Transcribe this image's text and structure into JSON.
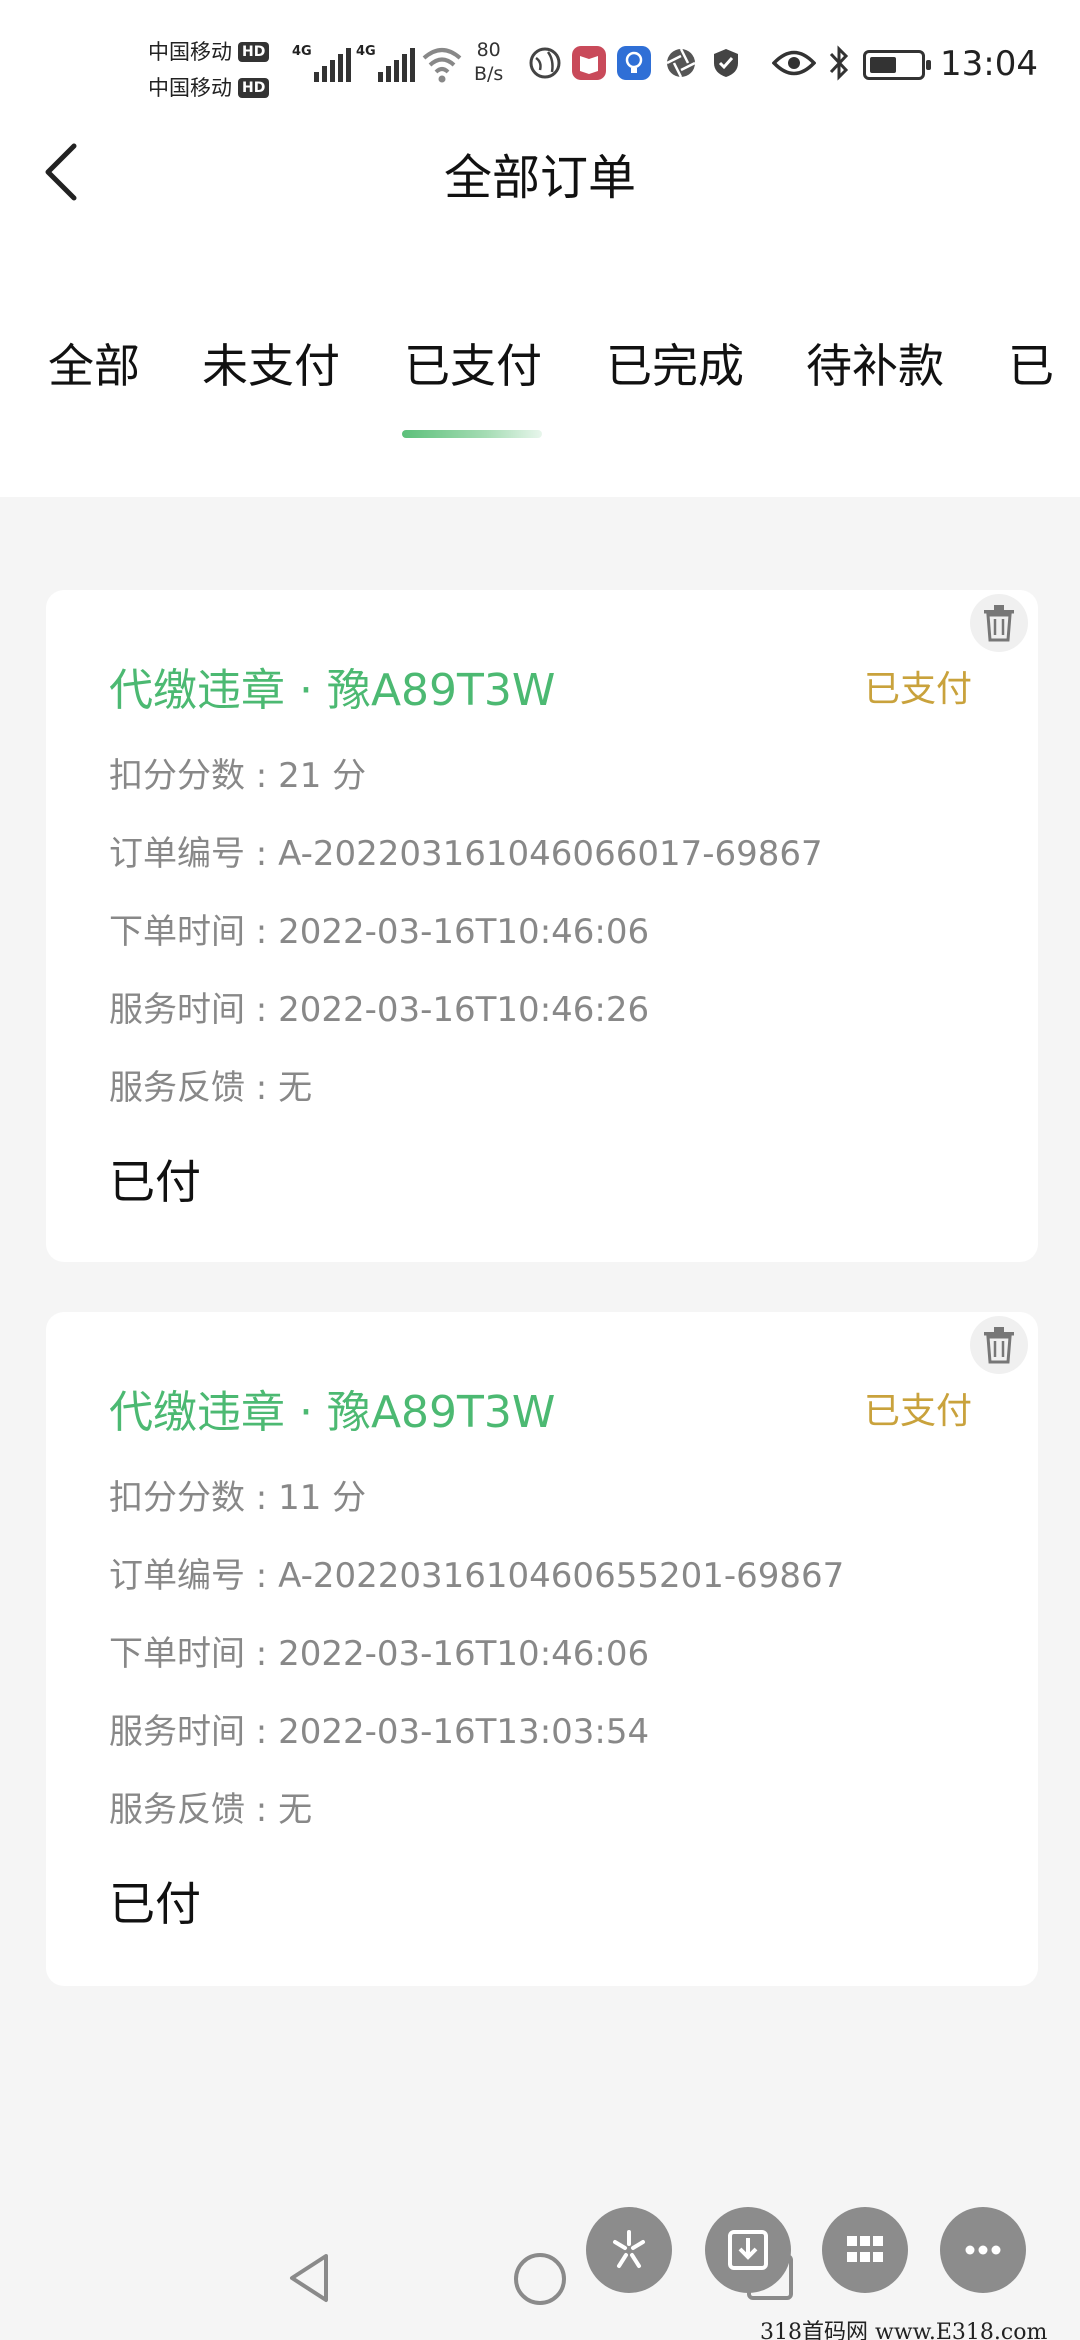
{
  "status_bar": {
    "carrier1": "中国移动",
    "carrier2": "中国移动",
    "hd_badge": "HD",
    "net_label": "4G",
    "speed_value": "80",
    "speed_unit": "B/s",
    "time": "13:04",
    "battery_level": 0.55
  },
  "header": {
    "title": "全部订单"
  },
  "tabs": [
    {
      "label": "全部"
    },
    {
      "label": "未支付"
    },
    {
      "label": "已支付"
    },
    {
      "label": "已完成"
    },
    {
      "label": "待补款"
    },
    {
      "label": "已"
    }
  ],
  "orders": [
    {
      "title": "代缴违章 · 豫A89T3W",
      "status": "已支付",
      "points": "扣分分数 : 21 分",
      "order_no": "订单编号 : A-202203161046066017-69867",
      "order_time": "下单时间 : 2022-03-16T10:46:06",
      "service_time": "服务时间 : 2022-03-16T10:46:26",
      "feedback": "服务反馈 : 无",
      "paid": "已付"
    },
    {
      "title": "代缴违章 · 豫A89T3W",
      "status": "已支付",
      "points": "扣分分数 : 11 分",
      "order_no": "订单编号 : A-202203161046065520​1-69867",
      "order_time": "下单时间 : 2022-03-16T10:46:06",
      "service_time": "服务时间 : 2022-03-16T13:03:54",
      "feedback": "服务反馈 : 无",
      "paid": "已付"
    }
  ],
  "watermark": "318首码网  www.E318.com",
  "colors": {
    "accent_green": "#4cb972",
    "status_gold": "#c9a23c"
  }
}
